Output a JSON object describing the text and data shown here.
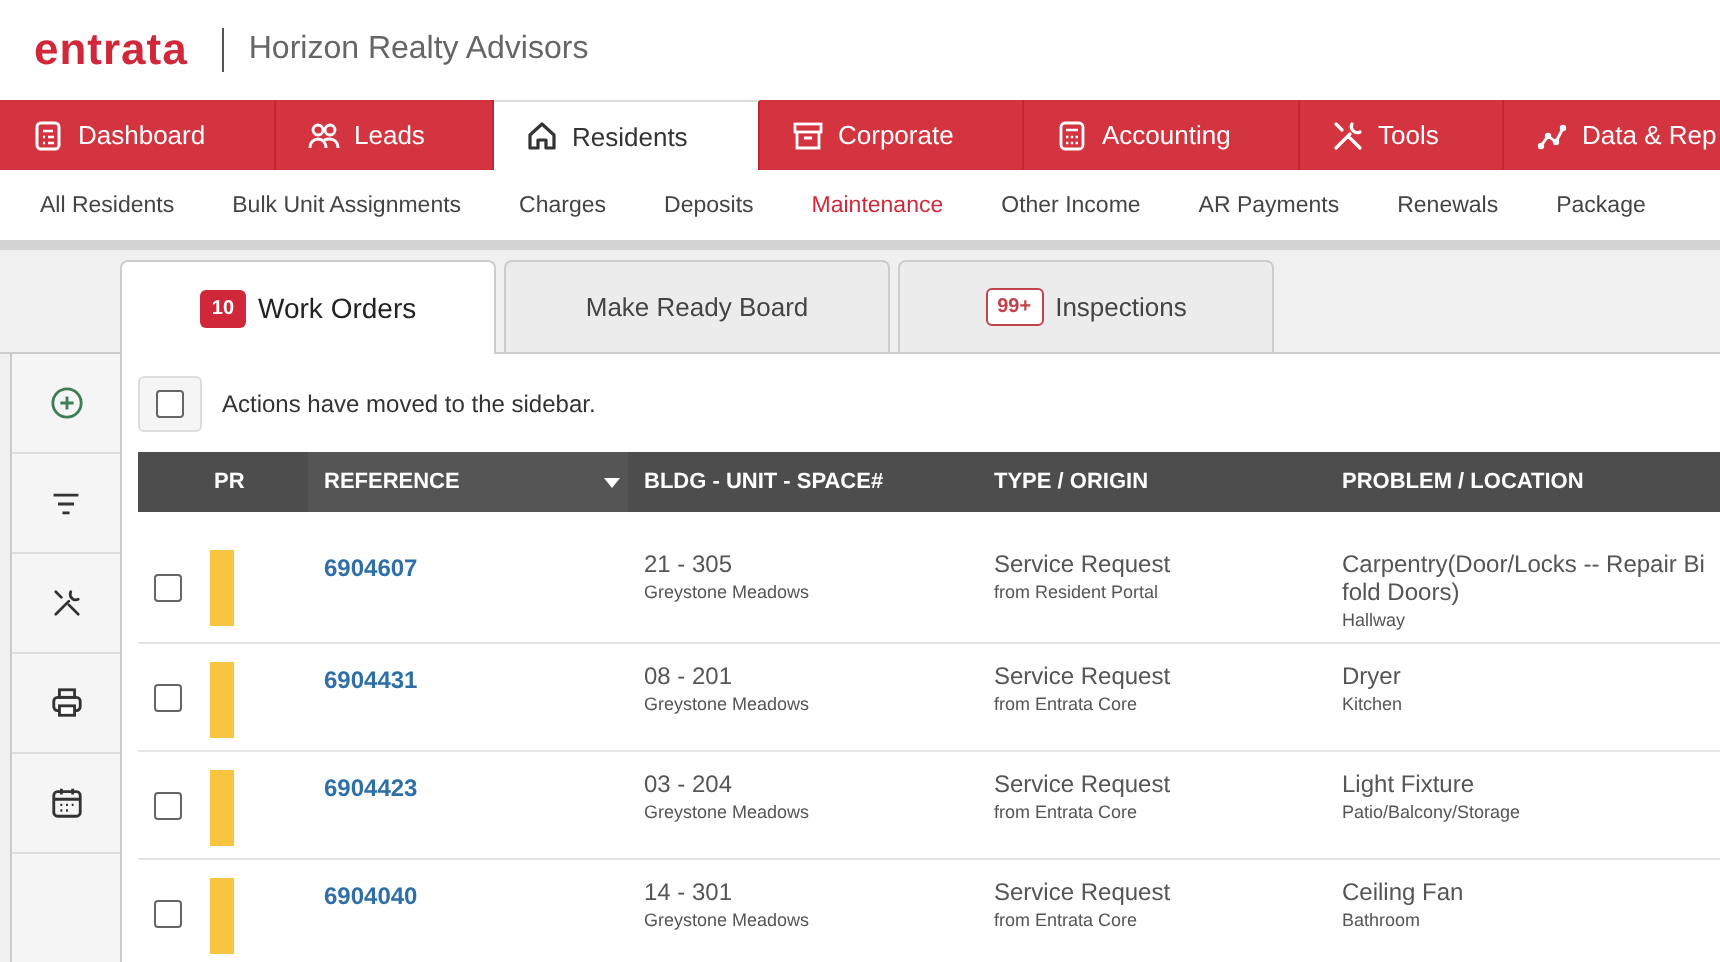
{
  "header": {
    "logo": "entrata",
    "company": "Horizon Realty Advisors"
  },
  "main_nav": [
    {
      "label": "Dashboard",
      "selected": false
    },
    {
      "label": "Leads",
      "selected": false
    },
    {
      "label": "Residents",
      "selected": true
    },
    {
      "label": "Corporate",
      "selected": false
    },
    {
      "label": "Accounting",
      "selected": false
    },
    {
      "label": "Tools",
      "selected": false
    },
    {
      "label": "Data & Rep",
      "selected": false
    }
  ],
  "sub_nav": [
    {
      "label": "All Residents",
      "selected": false
    },
    {
      "label": "Bulk Unit Assignments",
      "selected": false
    },
    {
      "label": "Charges",
      "selected": false
    },
    {
      "label": "Deposits",
      "selected": false
    },
    {
      "label": "Maintenance",
      "selected": true
    },
    {
      "label": "Other Income",
      "selected": false
    },
    {
      "label": "AR Payments",
      "selected": false
    },
    {
      "label": "Renewals",
      "selected": false
    },
    {
      "label": "Package",
      "selected": false
    }
  ],
  "tabs": [
    {
      "label": "Work Orders",
      "badge": "10",
      "selected": true
    },
    {
      "label": "Make Ready Board",
      "selected": false
    },
    {
      "label": "Inspections",
      "badge": "99+",
      "selected": false
    }
  ],
  "select_all": {
    "checked": false,
    "label": "Actions have moved to the sidebar."
  },
  "table": {
    "columns": [
      {
        "label": "PR",
        "sorted": false
      },
      {
        "label": "REFERENCE",
        "sorted": true
      },
      {
        "label": "BLDG - UNIT - SPACE#",
        "sorted": false
      },
      {
        "label": "TYPE / ORIGIN",
        "sorted": false
      },
      {
        "label": "PROBLEM / LOCATION",
        "sorted": false
      }
    ],
    "rows": [
      {
        "checked": false,
        "color": "#f9c440",
        "reference": "6904607",
        "unit": "21 - 305",
        "property": "Greystone Meadows",
        "type": "Service Request",
        "origin": "from Resident Portal",
        "problem": "Carpentry(Door/Locks -- Repair Bi fold Doors)",
        "location": "Hallway"
      },
      {
        "checked": false,
        "color": "#f9c440",
        "reference": "6904431",
        "unit": "08 - 201",
        "property": "Greystone Meadows",
        "type": "Service Request",
        "origin": "from Entrata Core",
        "problem": "Dryer",
        "location": "Kitchen"
      },
      {
        "checked": false,
        "color": "#f9c440",
        "reference": "6904423",
        "unit": "03 - 204",
        "property": "Greystone Meadows",
        "type": "Service Request",
        "origin": "from Entrata Core",
        "problem": "Light Fixture",
        "location": "Patio/Balcony/Storage"
      },
      {
        "checked": false,
        "color": "#f9c440",
        "reference": "6904040",
        "unit": "14 - 301",
        "property": "Greystone Meadows",
        "type": "Service Request",
        "origin": "from Entrata Core",
        "problem": "Ceiling Fan",
        "location": "Bathroom"
      }
    ]
  }
}
